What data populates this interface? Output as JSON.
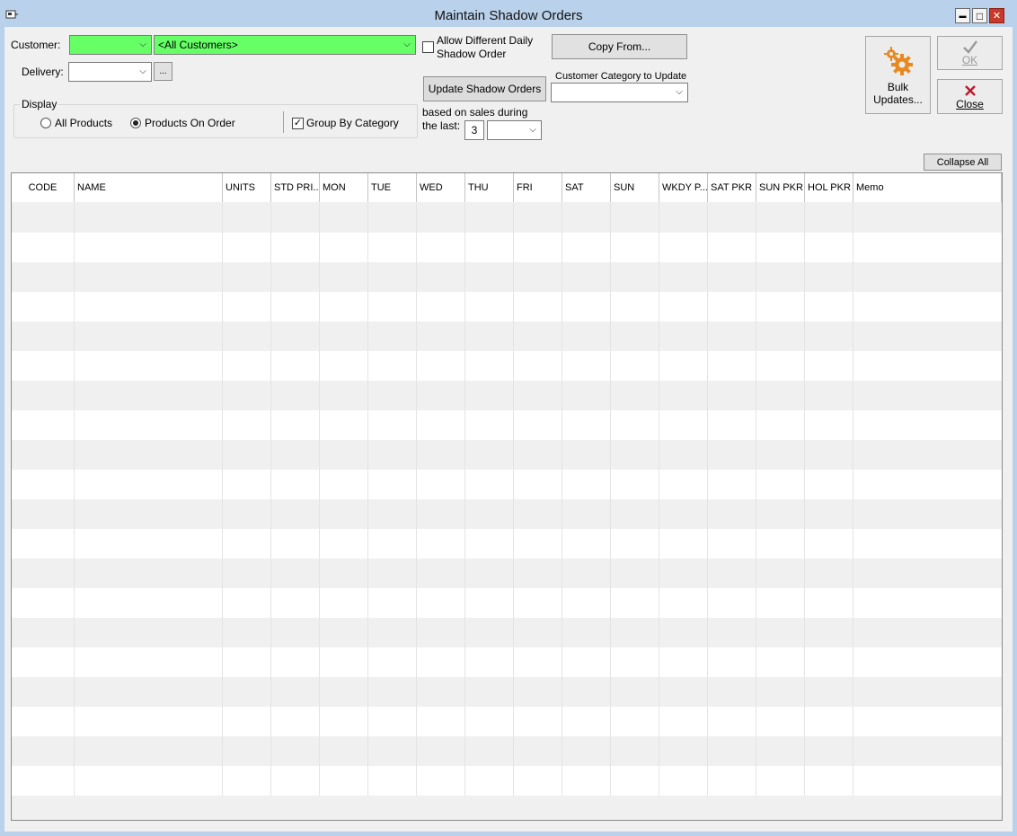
{
  "window": {
    "title": "Maintain Shadow Orders",
    "minimize_glyph": "▬",
    "maximize_glyph": "□",
    "close_glyph": "✕"
  },
  "customer": {
    "label": "Customer:",
    "code_value": "",
    "name_value": "<All Customers>"
  },
  "delivery": {
    "label": "Delivery:",
    "value": "",
    "browse_label": "..."
  },
  "display": {
    "group_title": "Display",
    "all_products_label": "All Products",
    "products_on_order_label": "Products On Order",
    "group_by_category_label": "Group By Category",
    "selected": "Products On Order",
    "group_by_category_checked": true
  },
  "allow_daily": {
    "label_line1": "Allow Different Daily",
    "label_line2": "Shadow Order",
    "checked": false
  },
  "update": {
    "button_label": "Update Shadow Orders",
    "based_on_line1": "based on sales during",
    "based_on_line2": "the last:",
    "count_value": "3",
    "period_value": ""
  },
  "copy_from_label": "Copy From...",
  "category": {
    "label": "Customer Category to Update",
    "value": ""
  },
  "bulk": {
    "line1": "Bulk",
    "line2": "Updates..."
  },
  "ok_label": "OK",
  "close_label": "Close",
  "collapse_all_label": "Collapse All",
  "colors": {
    "customer_field_bg": "#66ff66",
    "gear_icon": "#e8891f",
    "close_x": "#c0182a",
    "ok_check": "#9a9a9a"
  },
  "grid": {
    "columns": [
      "CODE",
      "NAME",
      "UNITS",
      "STD PRI...",
      "MON",
      "TUE",
      "WED",
      "THU",
      "FRI",
      "SAT",
      "SUN",
      "WKDY P...",
      "SAT PKR",
      "SUN PKR",
      "HOL PKR",
      "Memo"
    ],
    "row_count": 20
  }
}
